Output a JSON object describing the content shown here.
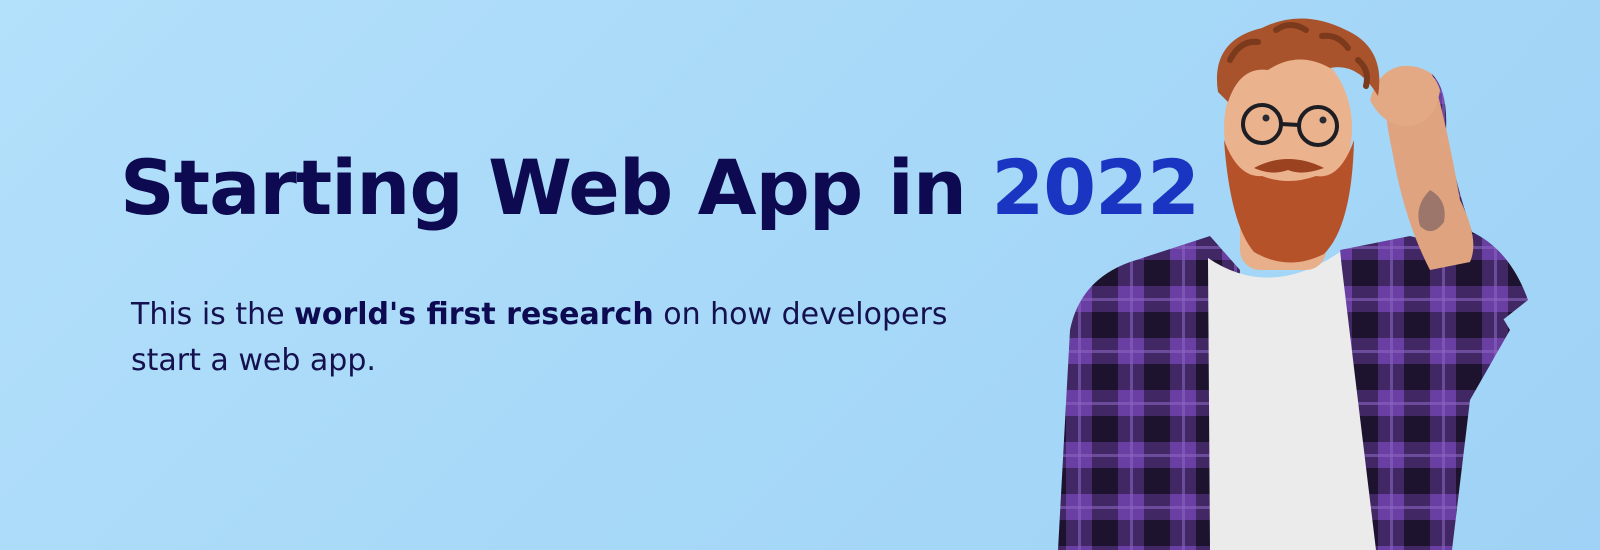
{
  "headline": {
    "text": "Starting Web App in",
    "year": "2022"
  },
  "subtitle": {
    "before": "This is the",
    "emphasis": "world's first research",
    "after": "on how developers start a web app."
  },
  "colors": {
    "background": "#aad9f8",
    "headline": "#0d0a52",
    "accent": "#1a35c2",
    "shirt_purple": "#6a3fa3",
    "shirt_dark": "#1e1530",
    "beard": "#b5522a"
  },
  "illustration": {
    "subject": "bearded man in purple plaid shirt scratching head"
  }
}
